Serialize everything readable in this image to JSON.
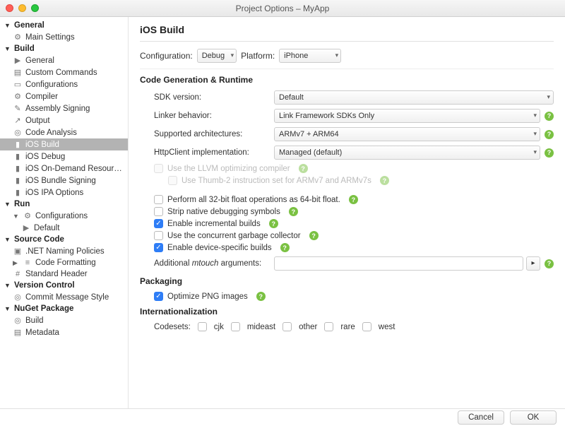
{
  "window_title": "Project Options – MyApp",
  "sidebar": {
    "groups": [
      {
        "label": "General",
        "items": [
          {
            "label": "Main Settings",
            "icon": "⚙"
          }
        ]
      },
      {
        "label": "Build",
        "items": [
          {
            "label": "General",
            "icon": "▶"
          },
          {
            "label": "Custom Commands",
            "icon": "▤"
          },
          {
            "label": "Configurations",
            "icon": "▭"
          },
          {
            "label": "Compiler",
            "icon": "⚙"
          },
          {
            "label": "Assembly Signing",
            "icon": "✎"
          },
          {
            "label": "Output",
            "icon": "↗"
          },
          {
            "label": "Code Analysis",
            "icon": "◎"
          },
          {
            "label": "iOS Build",
            "icon": "▮",
            "selected": true
          },
          {
            "label": "iOS Debug",
            "icon": "▮"
          },
          {
            "label": "iOS On-Demand Resources",
            "icon": "▮"
          },
          {
            "label": "iOS Bundle Signing",
            "icon": "▮"
          },
          {
            "label": "iOS IPA Options",
            "icon": "▮"
          }
        ]
      },
      {
        "label": "Run",
        "items": [
          {
            "label": "Configurations",
            "icon": "⚙",
            "expandable": true,
            "children": [
              {
                "label": "Default",
                "icon": "▶"
              }
            ]
          }
        ]
      },
      {
        "label": "Source Code",
        "items": [
          {
            "label": ".NET Naming Policies",
            "icon": "▣"
          },
          {
            "label": "Code Formatting",
            "icon": "≡",
            "expandable": true
          },
          {
            "label": "Standard Header",
            "icon": "#"
          }
        ]
      },
      {
        "label": "Version Control",
        "items": [
          {
            "label": "Commit Message Style",
            "icon": "◎"
          }
        ]
      },
      {
        "label": "NuGet Package",
        "items": [
          {
            "label": "Build",
            "icon": "◎"
          },
          {
            "label": "Metadata",
            "icon": "▤"
          }
        ]
      }
    ]
  },
  "page_title": "iOS Build",
  "top": {
    "config_label": "Configuration:",
    "config_value": "Debug",
    "platform_label": "Platform:",
    "platform_value": "iPhone"
  },
  "sections": {
    "code_gen": "Code Generation & Runtime",
    "packaging": "Packaging",
    "i18n": "Internationalization"
  },
  "fields": {
    "sdk_label": "SDK version:",
    "sdk_value": "Default",
    "linker_label": "Linker behavior:",
    "linker_value": "Link Framework SDKs Only",
    "arch_label": "Supported architectures:",
    "arch_value": "ARMv7 + ARM64",
    "http_label": "HttpClient implementation:",
    "http_value": "Managed (default)",
    "mtouch_label_a": "Additional ",
    "mtouch_label_b": "mtouch",
    "mtouch_label_c": " arguments:"
  },
  "checks": {
    "llvm": "Use the LLVM optimizing compiler",
    "thumb": "Use Thumb-2 instruction set for ARMv7 and ARMv7s",
    "float": "Perform all 32-bit float operations as 64-bit float.",
    "strip": "Strip native debugging symbols",
    "incremental": "Enable incremental builds",
    "gc": "Use the concurrent garbage collector",
    "device": "Enable device-specific builds",
    "png": "Optimize PNG images"
  },
  "codesets": {
    "label": "Codesets:",
    "items": [
      "cjk",
      "mideast",
      "other",
      "rare",
      "west"
    ]
  },
  "buttons": {
    "cancel": "Cancel",
    "ok": "OK"
  }
}
